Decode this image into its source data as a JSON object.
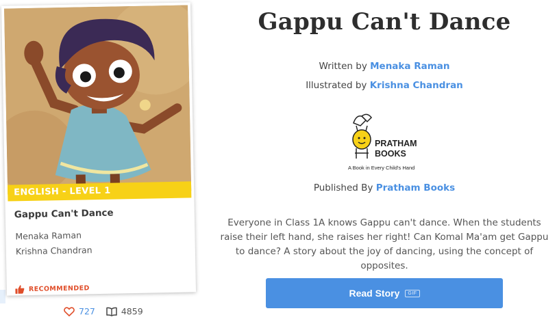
{
  "book": {
    "title": "Gappu Can't Dance",
    "level": "ENGLISH - LEVEL 1",
    "author": "Menaka Raman",
    "illustrator": "Krishna Chandran",
    "recommended_label": "RECOMMENDED",
    "likes": "727",
    "reads": "4859",
    "synopsis": "Everyone in Class 1A knows Gappu can't dance. When the students raise their left hand, she raises her right! Can Komal Ma'am get Gappu to dance? A story about the joy of dancing, using the concept of opposites."
  },
  "credits": {
    "written_by_label": "Written by",
    "illustrated_by_label": "Illustrated by",
    "published_by_label": "Published By",
    "publisher": "Pratham Books"
  },
  "publisher_logo": {
    "line1": "PRATHAM",
    "line2": "BOOKS",
    "tagline": "A Book in Every Child's Hand"
  },
  "actions": {
    "read_label": "Read Story",
    "read_badge": "GIF"
  },
  "icons": {
    "heart": "heart-icon",
    "book": "open-book-icon",
    "thumb": "thumbs-up-icon"
  },
  "colors": {
    "link": "#4a90e2",
    "ribbon": "#f7d117",
    "recommended": "#e04e2a",
    "button": "#4a90e2"
  }
}
